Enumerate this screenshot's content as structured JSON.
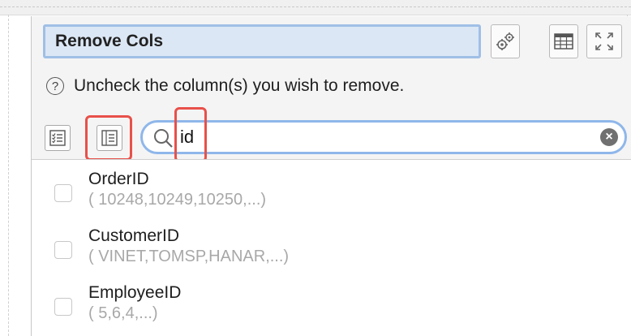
{
  "panel": {
    "title": "Remove Cols",
    "help_text": "Uncheck the column(s) you wish to remove."
  },
  "toolbar": {
    "settings_icon": "gears-icon",
    "table_icon": "table-icon",
    "expand_icon": "expand-icon",
    "select_all_icon": "checklist-icon",
    "deselect_all_icon": "list-icon"
  },
  "search": {
    "value": "id",
    "clear_label": "×"
  },
  "columns": [
    {
      "name": "OrderID",
      "values": "( 10248,10249,10250,...)",
      "checked": false
    },
    {
      "name": "CustomerID",
      "values": "( VINET,TOMSP,HANAR,...)",
      "checked": false
    },
    {
      "name": "EmployeeID",
      "values": "( 5,6,4,...)",
      "checked": false
    }
  ],
  "colors": {
    "highlight": "#e8504a",
    "title_bg": "#dce7f5",
    "focus_ring": "#8fb7ea"
  }
}
